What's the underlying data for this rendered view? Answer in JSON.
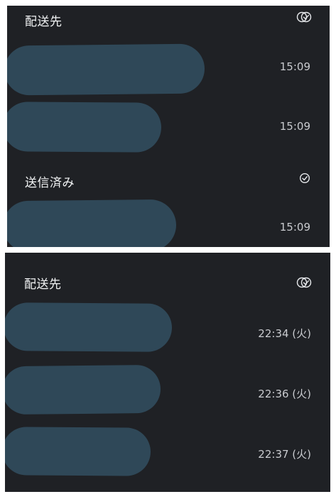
{
  "top_panel": {
    "recipients_header": "配送先",
    "recipients_icon": "double-check-icon",
    "recipient_rows": [
      {
        "time": "15:09"
      },
      {
        "time": "15:09"
      }
    ],
    "sent_header": "送信済み",
    "sent_icon": "single-check-icon",
    "sent_rows": [
      {
        "time": "15:09"
      }
    ]
  },
  "bottom_panel": {
    "recipients_header": "配送先",
    "recipients_icon": "double-check-icon",
    "recipient_rows": [
      {
        "time": "22:34 (火)"
      },
      {
        "time": "22:36 (火)"
      },
      {
        "time": "22:37 (火)"
      }
    ]
  },
  "colors": {
    "panel_bg": "#1f2125",
    "redaction": "#2f4858",
    "text": "#e8eaed"
  }
}
